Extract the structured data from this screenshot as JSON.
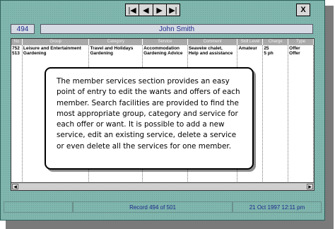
{
  "nav": {
    "first": "|◀",
    "prev": "◀",
    "next": "▶",
    "last": "▶|",
    "close": "X"
  },
  "member": {
    "id": "494",
    "name": "John Smith"
  },
  "table": {
    "columns": [
      "No",
      "Group",
      "Category",
      "Service",
      "Comment",
      "Skill Level",
      "Charge",
      "Type"
    ],
    "rows": [
      [
        "752",
        "Leisure and Entertainment",
        "Travel and Holidays",
        "Accommodation",
        "Seaveiw chalet,",
        "Amateur",
        "25",
        "Offer"
      ],
      [
        "513",
        "Gardening",
        "Gardening",
        "Gardening Advice",
        "Help and assistance",
        "",
        "5 ph",
        "Offer"
      ]
    ]
  },
  "callout_text": "The member services section provides an easy point of entry to edit the wants and offers of each member. Search facilities are provided to find the most appropriate group, category and service for each offer or want. It is possible to add a new service, edit an existing service, delete a service or even delete all the services for one member.",
  "status": {
    "left": "",
    "record": "Record 494 of 501",
    "datetime": "21 Oct 1997  12:11 pm"
  }
}
